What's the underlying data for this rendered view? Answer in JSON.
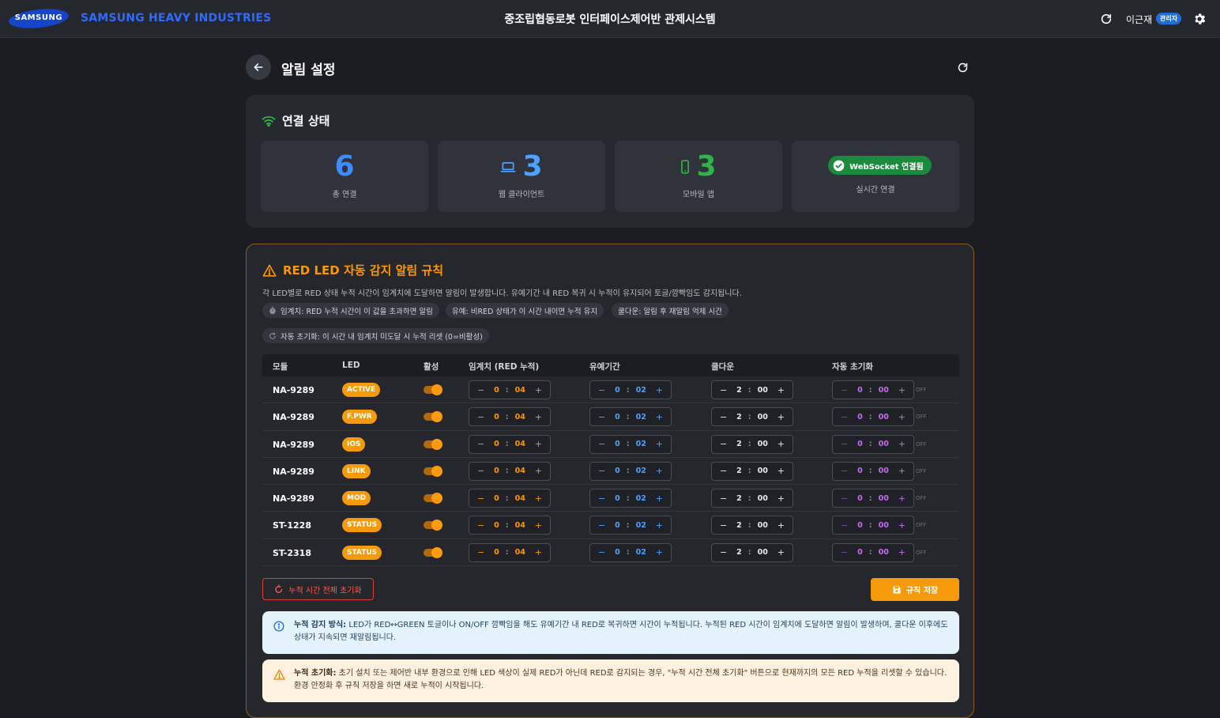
{
  "header": {
    "logo_text": "SAMSUNG",
    "brand": "SAMSUNG HEAVY INDUSTRIES",
    "title": "중조립협동로봇 인터페이스제어반 관제시스템",
    "user_name": "이근재",
    "user_role": "관리자"
  },
  "page": {
    "title": "알림 설정"
  },
  "connection": {
    "title": "연결 상태",
    "total": {
      "value": "6",
      "label": "총 연결"
    },
    "web": {
      "value": "3",
      "label": "웹 클라이언트"
    },
    "mobile": {
      "value": "3",
      "label": "모바일 앱"
    },
    "ws": {
      "badge": "WebSocket 연결됨",
      "label": "실시간 연결"
    }
  },
  "rules": {
    "title": "RED LED 자동 감지 알림 규칙",
    "description": "각 LED별로 RED 상태 누적 시간이 임계치에 도달하면 알림이 발생합니다. 유예기간 내 RED 복귀 시 누적이 유지되어 토글/깜빡임도 감지됩니다.",
    "chips": {
      "threshold": "임계치: RED 누적 시간이 이 값을 초과하면 알림",
      "grace": "유예: 비RED 상태가 이 시간 내이면 누적 유지",
      "cooldown": "쿨다운: 알림 후 재알림 억제 시간",
      "auto_reset": "자동 초기화: 이 시간 내 임계치 미도달 시 누적 리셋 (0=비활성)"
    },
    "columns": {
      "module": "모듈",
      "led": "LED",
      "active": "활성",
      "threshold": "임계치 (RED 누적)",
      "grace": "유예기간",
      "cooldown": "쿨다운",
      "auto_reset": "자동 초기화"
    },
    "rows": [
      {
        "module": "NA-9289",
        "led": "ACTIVE",
        "th_m": "0",
        "th_s": "04",
        "gr_m": "0",
        "gr_s": "02",
        "cd_m": "2",
        "cd_s": "00",
        "ar_m": "0",
        "ar_s": "00",
        "ar_state": "OFF"
      },
      {
        "module": "NA-9289",
        "led": "F.PWR",
        "th_m": "0",
        "th_s": "04",
        "gr_m": "0",
        "gr_s": "02",
        "cd_m": "2",
        "cd_s": "00",
        "ar_m": "0",
        "ar_s": "00",
        "ar_state": "OFF"
      },
      {
        "module": "NA-9289",
        "led": "IOS",
        "th_m": "0",
        "th_s": "04",
        "gr_m": "0",
        "gr_s": "02",
        "cd_m": "2",
        "cd_s": "00",
        "ar_m": "0",
        "ar_s": "00",
        "ar_state": "OFF"
      },
      {
        "module": "NA-9289",
        "led": "LINK",
        "th_m": "0",
        "th_s": "04",
        "gr_m": "0",
        "gr_s": "02",
        "cd_m": "2",
        "cd_s": "00",
        "ar_m": "0",
        "ar_s": "00",
        "ar_state": "OFF"
      },
      {
        "module": "NA-9289",
        "led": "MOD",
        "th_m": "0",
        "th_s": "04",
        "gr_m": "0",
        "gr_s": "02",
        "cd_m": "2",
        "cd_s": "00",
        "ar_m": "0",
        "ar_s": "00",
        "ar_state": "OFF"
      },
      {
        "module": "ST-1228",
        "led": "STATUS",
        "th_m": "0",
        "th_s": "04",
        "gr_m": "0",
        "gr_s": "02",
        "cd_m": "2",
        "cd_s": "00",
        "ar_m": "0",
        "ar_s": "00",
        "ar_state": "OFF"
      },
      {
        "module": "ST-2318",
        "led": "STATUS",
        "th_m": "0",
        "th_s": "04",
        "gr_m": "0",
        "gr_s": "02",
        "cd_m": "2",
        "cd_s": "00",
        "ar_m": "0",
        "ar_s": "00",
        "ar_state": "OFF"
      }
    ],
    "reset_all_label": "누적 시간 전체 초기화",
    "save_label": "규칙 저장"
  },
  "notes": {
    "info_title": "누적 감지 방식:",
    "info_text": " LED가 RED↔GREEN 토글이나 ON/OFF 깜빡임을 해도 유예기간 내 RED로 복귀하면 시간이 누적됩니다. 누적된 RED 시간이 임계치에 도달하면 알림이 발생하며, 쿨다운 이후에도 상태가 지속되면 재알림됩니다.",
    "warn_title": "누적 초기화:",
    "warn_text": " 초기 설치 또는 제어반 내부 환경으로 인해 LED 색상이 실제 RED가 아닌데 RED로 감지되는 경우, \"누적 시간 전체 초기화\" 버튼으로 현재까지의 모든 RED 누적을 리셋할 수 있습니다. 환경 안정화 후 규칙 저장을 하면 새로 누적이 시작됩니다."
  },
  "colors": {
    "accent": "#f59b0b",
    "threshold": "#ff9800",
    "grace": "#4da3ff",
    "cooldown": "#e6e8ec",
    "auto_reset": "#c56cf0",
    "brand": "#2f6bff"
  },
  "icons": [
    "refresh-icon",
    "settings-icon",
    "back-arrow-icon",
    "wifi-icon",
    "laptop-icon",
    "phone-icon",
    "check-circle-icon",
    "warning-icon",
    "timer-icon",
    "reset-icon",
    "save-icon",
    "info-icon"
  ]
}
